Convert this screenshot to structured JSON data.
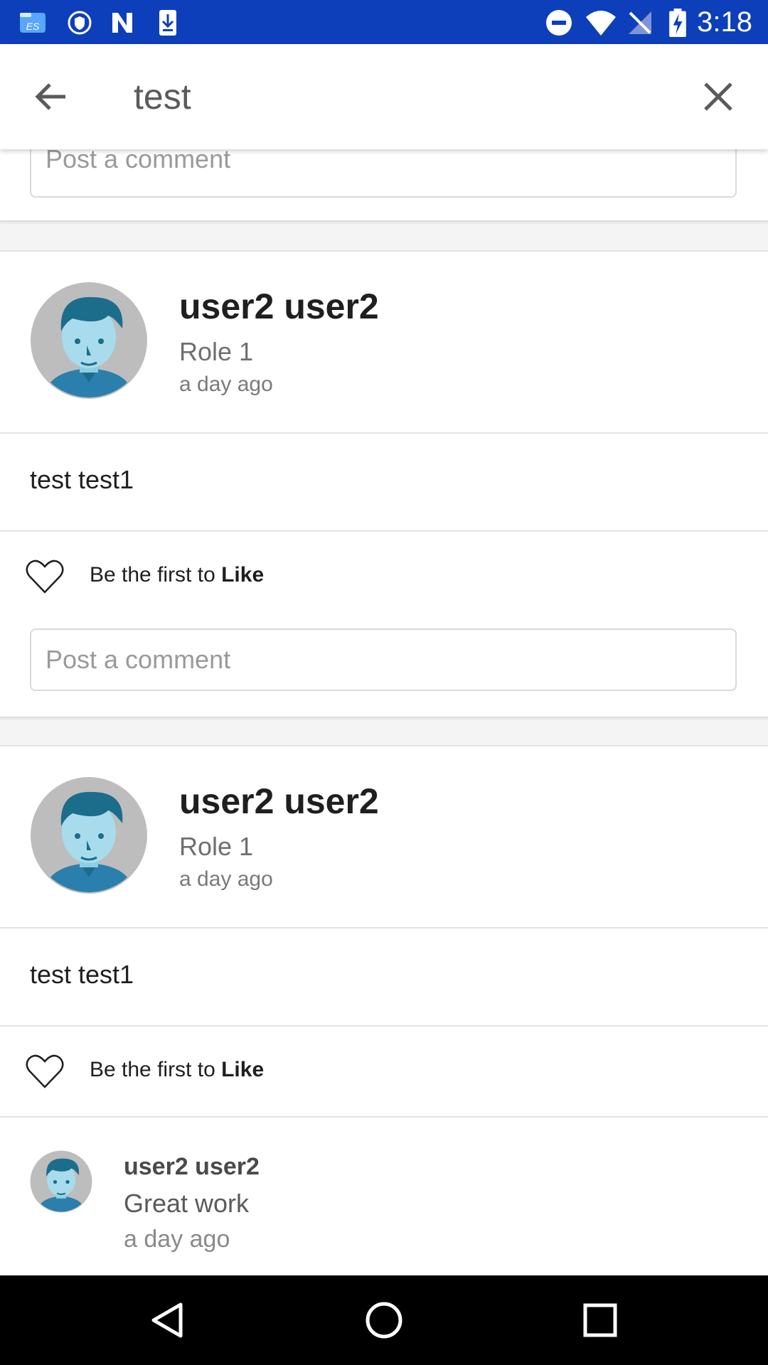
{
  "status_bar": {
    "time": "3:18"
  },
  "search": {
    "query": "test"
  },
  "top_comment_placeholder": "Post a comment",
  "posts": [
    {
      "author": "user2 user2",
      "role": "Role 1",
      "time": "a day ago",
      "text": "test test1",
      "like_prefix": "Be the first to ",
      "like_strong": "Like",
      "comment_placeholder": "Post a comment"
    },
    {
      "author": "user2 user2",
      "role": "Role 1",
      "time": "a day ago",
      "text": "test test1",
      "like_prefix": "Be the first to ",
      "like_strong": "Like",
      "reply": {
        "author": "user2 user2",
        "text": "Great work",
        "time": "a day ago"
      }
    }
  ],
  "colors": {
    "status_bar": "#0d3fbb",
    "avatar_bg": "#bdbdbd",
    "avatar_face": "#a8dcec",
    "avatar_hair": "#1c6d8c"
  }
}
